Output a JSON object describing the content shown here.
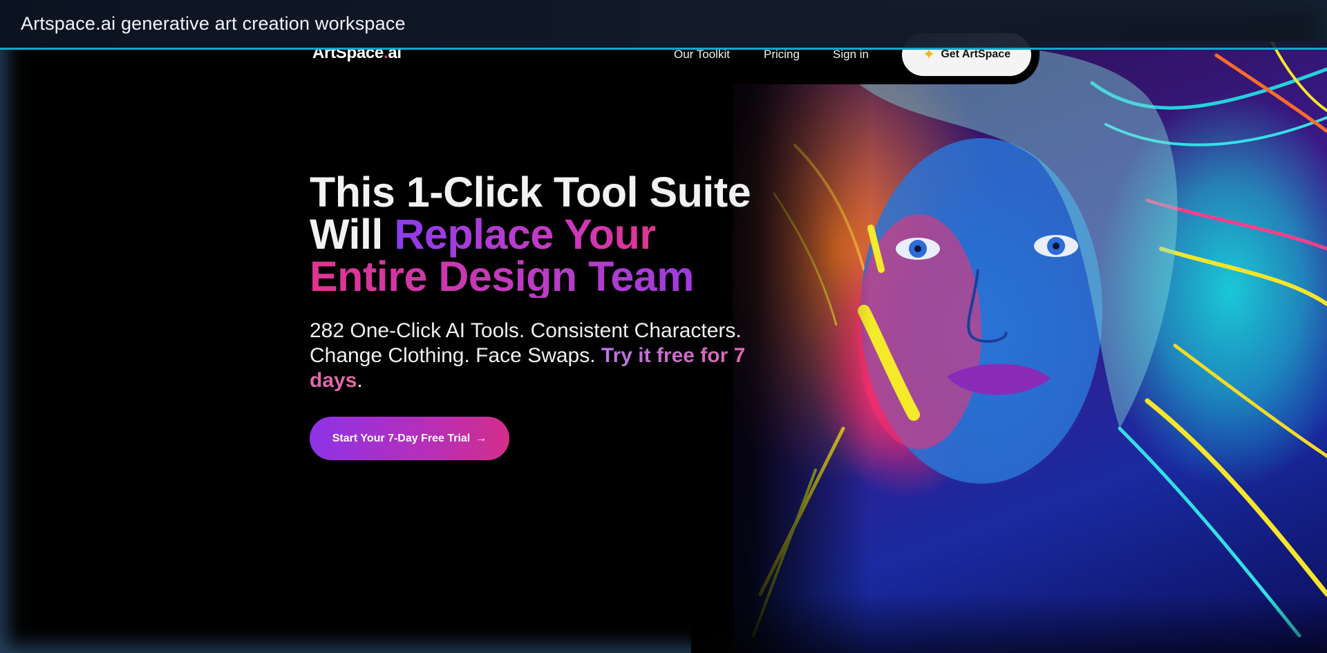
{
  "window": {
    "title": "Artspace.ai generative art creation workspace"
  },
  "nav": {
    "logo_main": "ArtSpace",
    "logo_dot": ".",
    "logo_suffix": "ai",
    "links": [
      {
        "label": "Our Toolkit"
      },
      {
        "label": "Pricing"
      },
      {
        "label": "Sign in"
      }
    ],
    "cta_label": "Get ArtSpace",
    "cta_icon": "sparkle-icon"
  },
  "hero": {
    "headline": {
      "line1": "This 1-Click Tool Suite",
      "line2_plain": "Will ",
      "line2_accent": "Replace Your",
      "line3_accent": "Entire Design Team"
    },
    "subtext": {
      "plain": "282 One-Click AI Tools. Consistent Characters. Change Clothing. Face Swaps. ",
      "accent": "Try it free for 7 days",
      "end": "."
    },
    "cta_label": "Start Your 7-Day Free Trial",
    "cta_arrow": "→",
    "image_subject": "neon-portrait-illustration"
  },
  "colors": {
    "accent_purple": "#8b3dee",
    "accent_pink": "#e0358f",
    "titlebar_border": "#16a6c9",
    "background": "#000000"
  }
}
